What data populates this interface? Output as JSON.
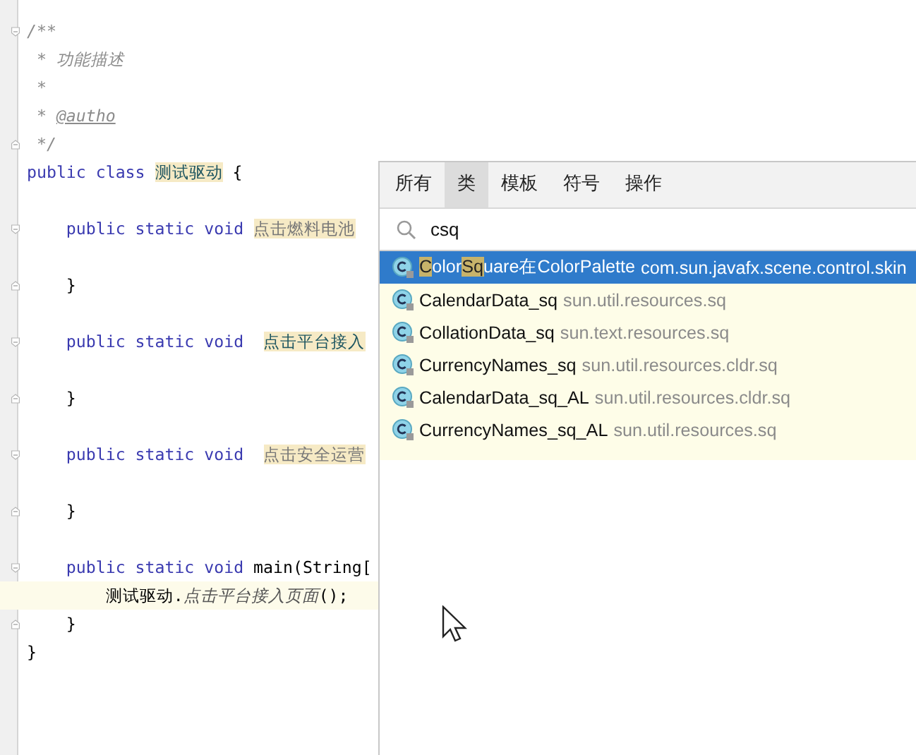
{
  "editor": {
    "lines": [
      {
        "fold_start": true,
        "segments": [
          {
            "kind": "comment",
            "text": "/**"
          }
        ]
      },
      {
        "segments": [
          {
            "kind": "comment",
            "text": " * 功能描述"
          }
        ]
      },
      {
        "segments": [
          {
            "kind": "comment",
            "text": " *"
          }
        ]
      },
      {
        "segments": [
          {
            "kind": "comment",
            "text": " * "
          },
          {
            "kind": "doctag",
            "text": "@autho"
          }
        ]
      },
      {
        "fold_end": true,
        "segments": [
          {
            "kind": "comment",
            "text": " */"
          }
        ]
      },
      {
        "segments": [
          {
            "kind": "keyword",
            "text": "public class "
          },
          {
            "kind": "highlight",
            "text": "测试驱动"
          },
          {
            "kind": "plain",
            "text": " {"
          }
        ]
      },
      {
        "blank_before": true,
        "fold_start": true,
        "segments": [
          {
            "kind": "keyword",
            "text": "    public static void "
          },
          {
            "kind": "highlight-grey",
            "text": "点击燃料电池"
          }
        ]
      },
      {
        "blank_before": true,
        "fold_end": true,
        "segments": [
          {
            "kind": "plain",
            "text": "    }"
          }
        ]
      },
      {
        "blank_before": true,
        "fold_start": true,
        "segments": [
          {
            "kind": "keyword",
            "text": "    public static void  "
          },
          {
            "kind": "highlight",
            "text": "点击平台接入"
          }
        ]
      },
      {
        "blank_before": true,
        "fold_end": true,
        "segments": [
          {
            "kind": "plain",
            "text": "    }"
          }
        ]
      },
      {
        "blank_before": true,
        "fold_start": true,
        "segments": [
          {
            "kind": "keyword",
            "text": "    public static void  "
          },
          {
            "kind": "highlight-grey",
            "text": "点击安全运营"
          }
        ]
      },
      {
        "blank_before": true,
        "fold_end": true,
        "segments": [
          {
            "kind": "plain",
            "text": "    }"
          }
        ]
      },
      {
        "blank_before": true,
        "fold_start": true,
        "segments": [
          {
            "kind": "keyword",
            "text": "    public static void "
          },
          {
            "kind": "plain",
            "text": "main(String["
          }
        ]
      },
      {
        "current": true,
        "segments": [
          {
            "kind": "plain",
            "text": "        测试驱动."
          },
          {
            "kind": "static-call",
            "text": "点击平台接入页面"
          },
          {
            "kind": "plain",
            "text": "();"
          }
        ]
      },
      {
        "fold_end": true,
        "segments": [
          {
            "kind": "plain",
            "text": "    }"
          }
        ]
      },
      {
        "segments": [
          {
            "kind": "plain",
            "text": "}"
          }
        ]
      }
    ]
  },
  "popup": {
    "tabs": [
      {
        "label": "所有",
        "selected": false
      },
      {
        "label": "类",
        "selected": true
      },
      {
        "label": "模板",
        "selected": false
      },
      {
        "label": "符号",
        "selected": false
      },
      {
        "label": "操作",
        "selected": false
      }
    ],
    "search": {
      "value": "csq"
    },
    "results": [
      {
        "selected": true,
        "name": [
          {
            "text": "C",
            "match": true
          },
          {
            "text": "olor",
            "match": false
          },
          {
            "text": "Sq",
            "match": true
          },
          {
            "text": "uare在ColorPalette",
            "match": false
          }
        ],
        "package": "com.sun.javafx.scene.control.skin"
      },
      {
        "selected": false,
        "name": [
          {
            "text": "CalendarData_sq",
            "match": false
          }
        ],
        "package": "sun.util.resources.sq"
      },
      {
        "selected": false,
        "name": [
          {
            "text": "CollationData_sq",
            "match": false
          }
        ],
        "package": "sun.text.resources.sq"
      },
      {
        "selected": false,
        "name": [
          {
            "text": "CurrencyNames_sq",
            "match": false
          }
        ],
        "package": "sun.util.resources.cldr.sq"
      },
      {
        "selected": false,
        "name": [
          {
            "text": "CalendarData_sq_AL",
            "match": false
          }
        ],
        "package": "sun.util.resources.cldr.sq"
      },
      {
        "selected": false,
        "name": [
          {
            "text": "CurrencyNames_sq_AL",
            "match": false
          }
        ],
        "package": "sun.util.resources.sq"
      }
    ]
  }
}
